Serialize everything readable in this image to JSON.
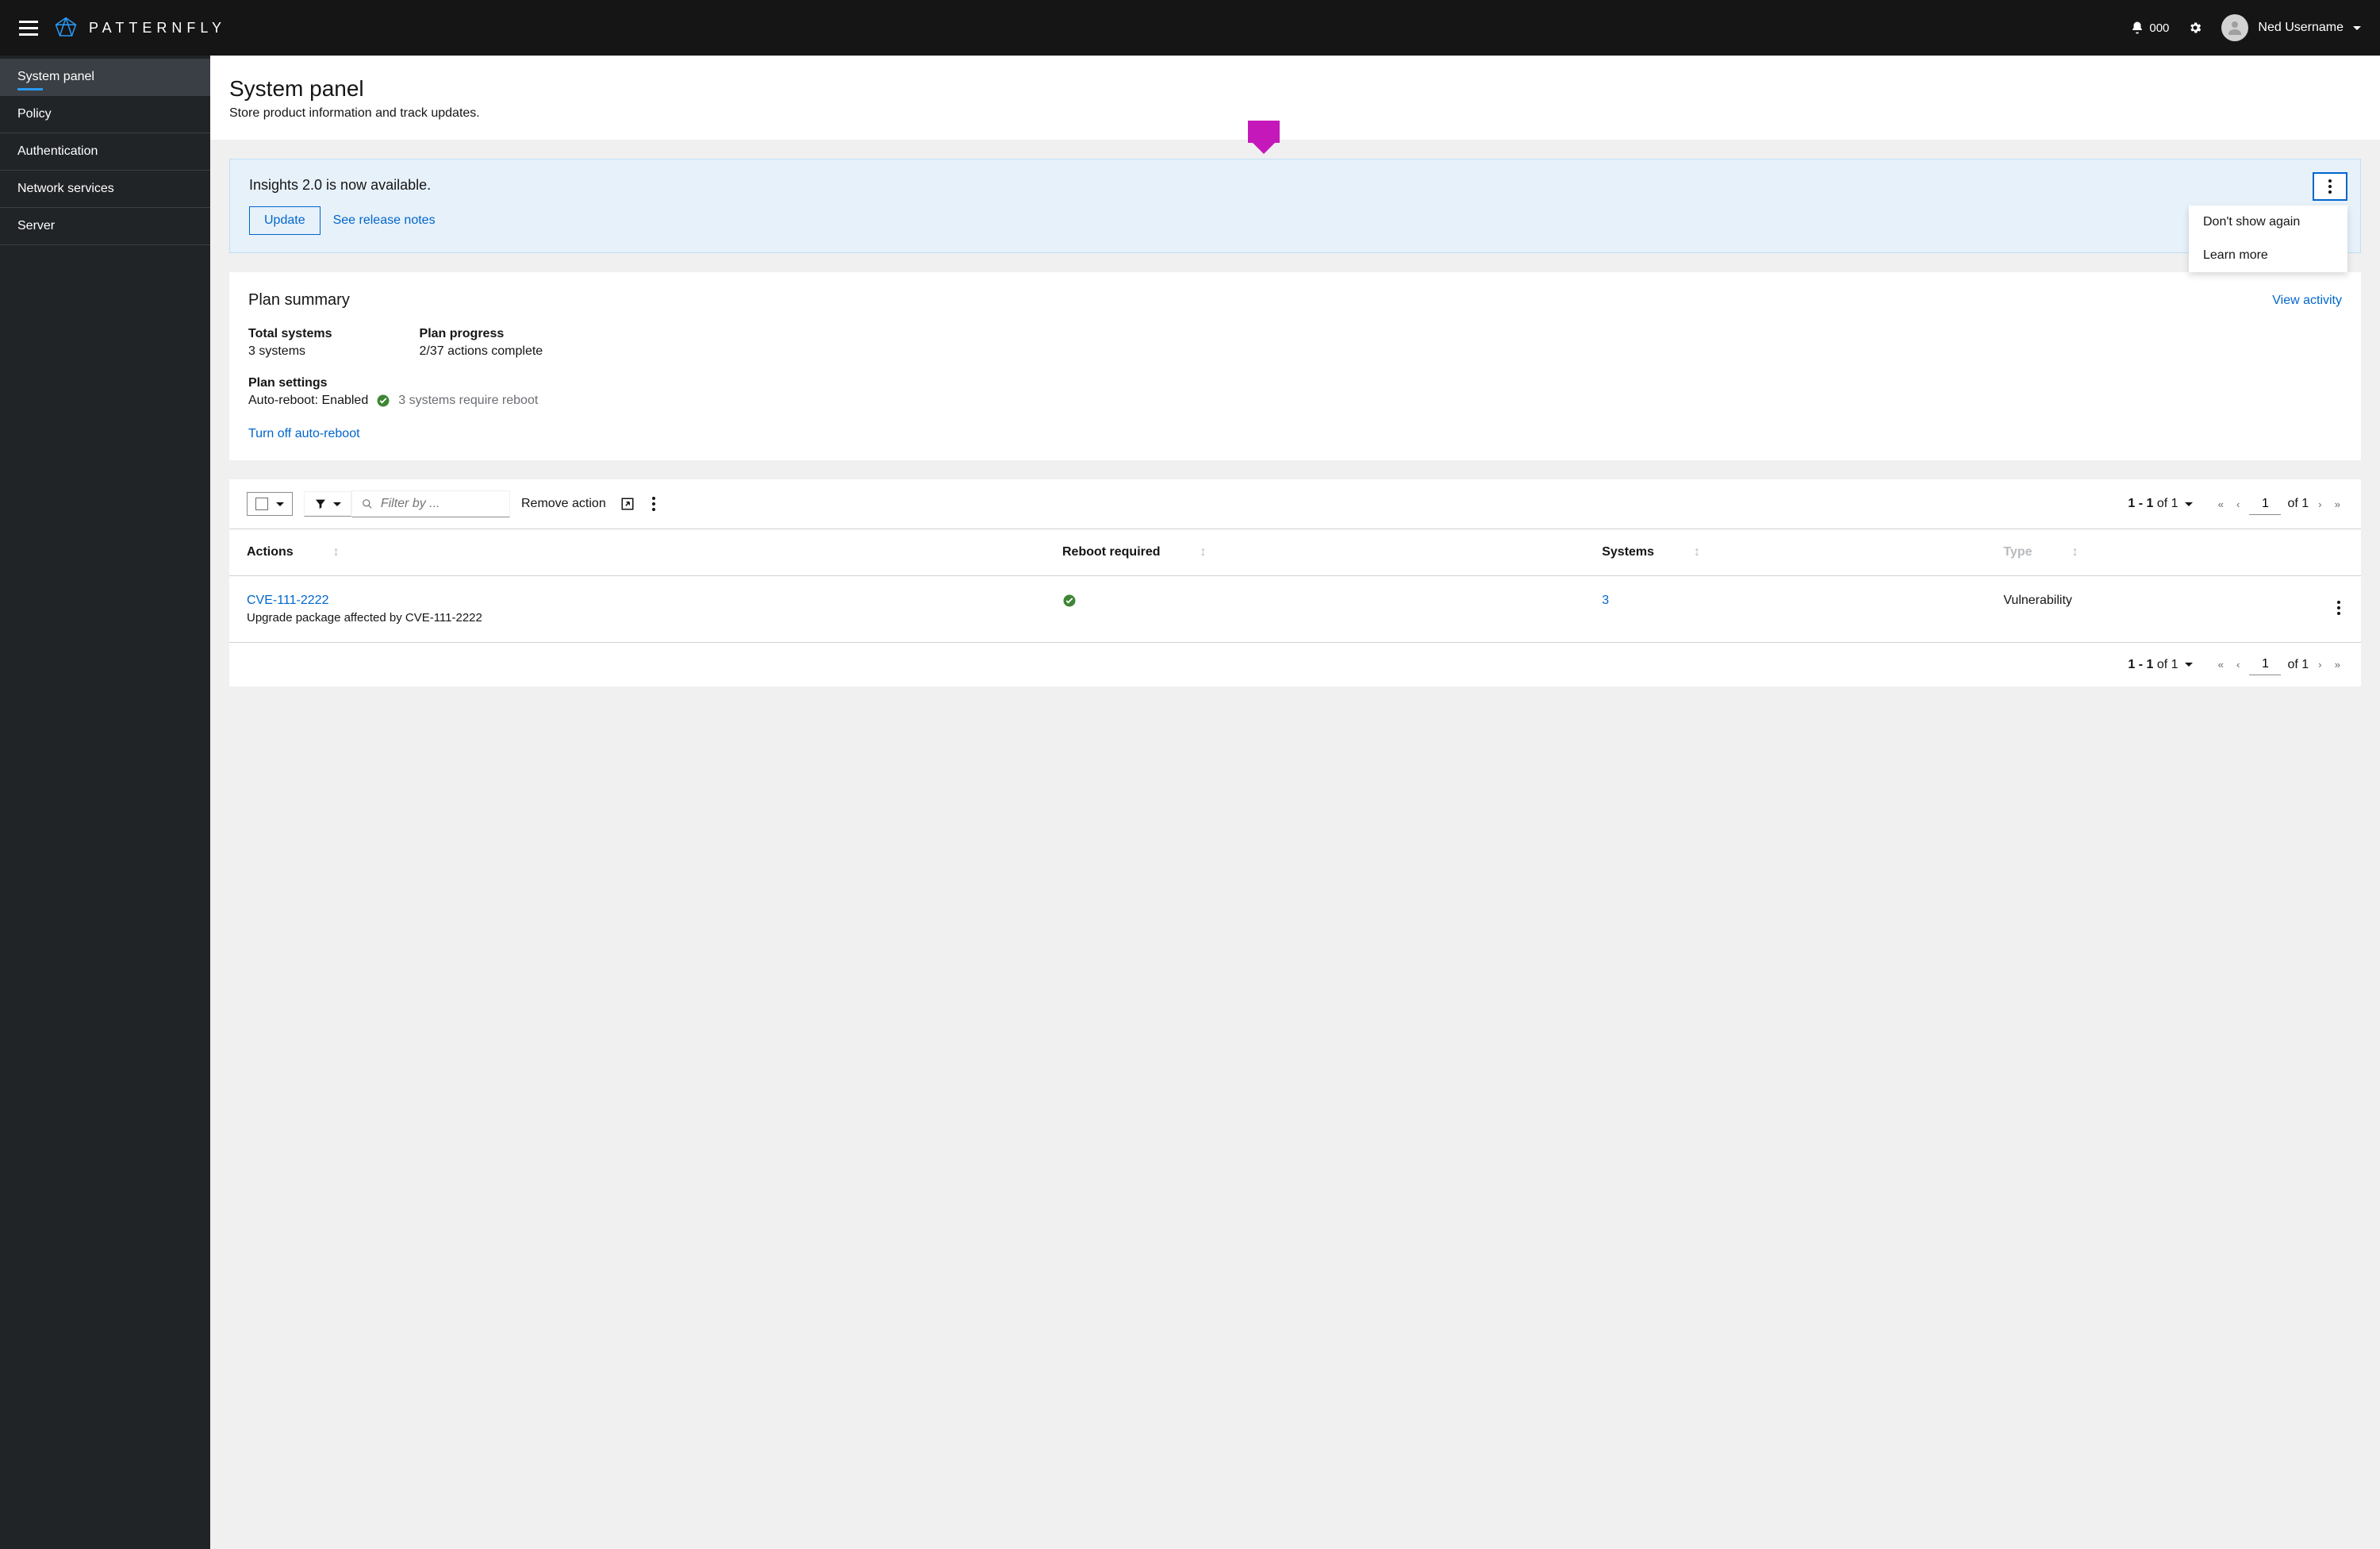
{
  "header": {
    "brand": "PATTERNFLY",
    "notification_count": "000",
    "username": "Ned Username"
  },
  "sidebar": {
    "items": [
      {
        "label": "System panel",
        "active": true
      },
      {
        "label": "Policy",
        "active": false
      },
      {
        "label": "Authentication",
        "active": false
      },
      {
        "label": "Network services",
        "active": false
      },
      {
        "label": "Server",
        "active": false
      }
    ]
  },
  "page": {
    "title": "System panel",
    "subtitle": "Store product information and track updates."
  },
  "hint": {
    "title": "Insights 2.0 is now available.",
    "primary_action": "Update",
    "secondary_action": "See release notes",
    "menu": [
      "Don't show again",
      "Learn more"
    ]
  },
  "plan": {
    "title": "Plan summary",
    "view_link": "View activity",
    "total_label": "Total systems",
    "total_value": "3 systems",
    "progress_label": "Plan progress",
    "progress_value": "2/37 actions complete",
    "settings_label": "Plan settings",
    "settings_value": "Auto-reboot: Enabled",
    "settings_helper": "3 systems require reboot",
    "toggle_link": "Turn off auto-reboot"
  },
  "toolbar": {
    "filter_placeholder": "Filter by ...",
    "remove_action": "Remove action"
  },
  "pagination": {
    "range": "1 - 1",
    "of_text": "of 1",
    "current": "1",
    "of_pages": "of 1"
  },
  "table": {
    "columns": {
      "actions": "Actions",
      "reboot": "Reboot required",
      "systems": "Systems",
      "type": "Type"
    },
    "rows": [
      {
        "action_link": "CVE-111-2222",
        "action_desc": "Upgrade package affected by CVE-111-2222",
        "reboot": true,
        "systems": "3",
        "type": "Vulnerability"
      }
    ]
  }
}
